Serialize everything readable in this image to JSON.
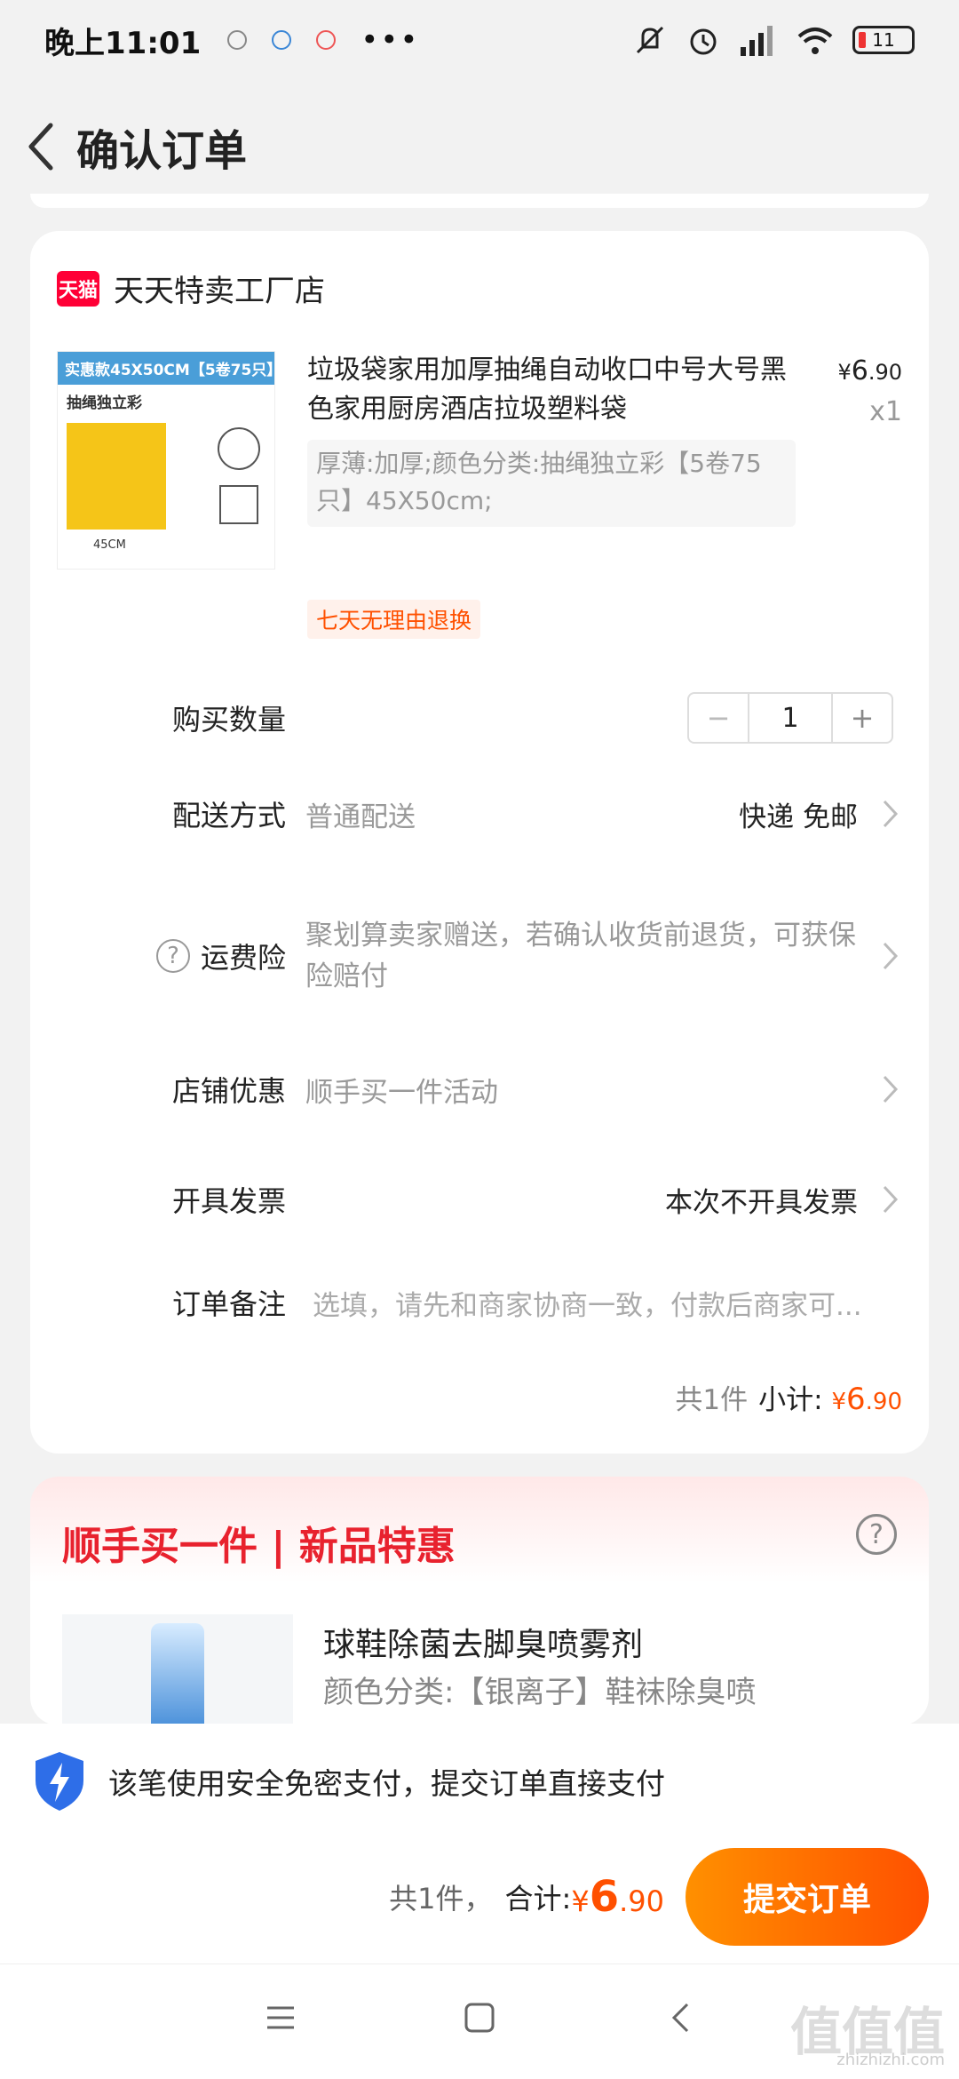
{
  "status": {
    "time": "晚上11:01",
    "more": "•••",
    "battery": "11"
  },
  "header": {
    "title": "确认订单"
  },
  "shop": {
    "badge": "天猫",
    "name": "天天特卖工厂店"
  },
  "product": {
    "image_banner": "实惠款45X50CM【5卷75只】",
    "image_sub": "抽绳独立彩",
    "image_size": "45CM",
    "title": "垃圾袋家用加厚抽绳自动收口中号大号黑色家用厨房酒店拉圾塑料袋",
    "price_symbol": "¥",
    "price_int": "6",
    "price_dec": ".90",
    "quantity": "x1",
    "spec": "厚薄:加厚;颜色分类:抽绳独立彩【5卷75只】45X50cm;",
    "return_tag": "七天无理由退换"
  },
  "rows": {
    "qty_label": "购买数量",
    "qty_minus": "−",
    "qty_value": "1",
    "qty_plus": "+",
    "delivery_label": "配送方式",
    "delivery_value": "普通配送",
    "delivery_right": "快递 免邮",
    "insurance_label": "运费险",
    "insurance_help": "?",
    "insurance_value": "聚划算卖家赠送，若确认收货前退货，可获保险赔付",
    "discount_label": "店铺优惠",
    "discount_value": "顺手买一件活动",
    "invoice_label": "开具发票",
    "invoice_right": "本次不开具发票",
    "note_label": "订单备注",
    "note_placeholder": "选填，请先和商家协商一致，付款后商家可..."
  },
  "subtotal": {
    "count": "共1件",
    "label": "小计:",
    "symbol": "¥",
    "int": "6",
    "dec": ".90"
  },
  "promo": {
    "title": "顺手买一件 | 新品特惠",
    "help": "?",
    "item_name": "球鞋除菌去脚臭喷雾剂",
    "item_spec": "颜色分类:【银离子】鞋袜除臭喷"
  },
  "bottom": {
    "secure_text": "该笔使用安全免密支付，提交订单直接支付",
    "total_count": "共1件，",
    "total_label": "合计:",
    "total_symbol": "¥",
    "total_int": "6",
    "total_dec": ".90",
    "submit": "提交订单"
  },
  "watermark": {
    "text": "值值值",
    "sub": "zhizhizhi.com"
  },
  "colors": {
    "accent": "#ff5000",
    "promo_red": "#e8222e",
    "tmall_red": "#ff0036"
  }
}
